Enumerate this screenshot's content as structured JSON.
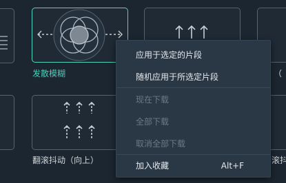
{
  "transitions": [
    {
      "label": "发散模糊",
      "selected": true
    },
    {
      "label": "翻滚抖动（向上）",
      "selected": false
    }
  ],
  "partial_labels": {
    "right_row1": "（",
    "right_row2": "滚抖"
  },
  "context_menu": {
    "items": [
      {
        "label": "应用于选定的片段",
        "enabled": true
      },
      {
        "label": "随机应用于所选定片段",
        "enabled": true
      },
      {
        "label": "现在下载",
        "enabled": false
      },
      {
        "label": "全部下载",
        "enabled": false
      },
      {
        "label": "取消全部下载",
        "enabled": false
      },
      {
        "label": "加入收藏",
        "enabled": true,
        "shortcut": "Alt+F"
      }
    ]
  },
  "colors": {
    "background": "#1c2630",
    "accent": "#47cdb8",
    "menu_bg": "#2a3744",
    "disabled_text": "#6d7a86"
  },
  "icons": [
    "blur-diverge-icon",
    "up-arrows-icon"
  ]
}
